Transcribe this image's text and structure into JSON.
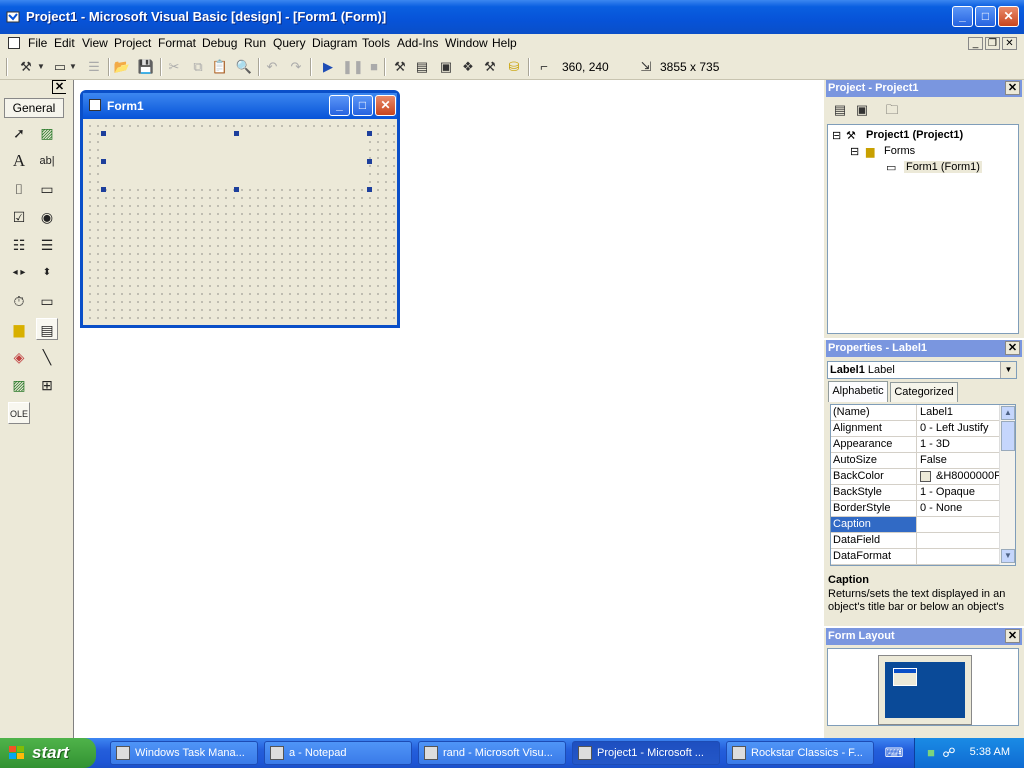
{
  "window": {
    "title": "Project1 - Microsoft Visual Basic [design] - [Form1 (Form)]",
    "minimize": "_",
    "maximize": "□",
    "close": "✕"
  },
  "menu": [
    "File",
    "Edit",
    "View",
    "Project",
    "Format",
    "Debug",
    "Run",
    "Query",
    "Diagram",
    "Tools",
    "Add-Ins",
    "Window",
    "Help"
  ],
  "toolbar": {
    "position": "360, 240",
    "size": "3855 x 735"
  },
  "toolbox": {
    "tab_label": "General",
    "close": "✕",
    "tools": [
      "pointer",
      "picturebox",
      "label",
      "textbox",
      "frame",
      "commandbutton",
      "checkbox",
      "optionbutton",
      "combobox",
      "listbox",
      "hscrollbar",
      "vscrollbar",
      "timer",
      "drivelistbox",
      "dirlistbox",
      "filelistbox",
      "shape",
      "line",
      "image",
      "data",
      "ole"
    ]
  },
  "form1": {
    "title": "Form1",
    "minimize": "_",
    "maximize": "□",
    "close": "✕"
  },
  "project_panel": {
    "title": "Project - Project1",
    "close": "✕",
    "tree": {
      "root": "Project1 (Project1)",
      "folder": "Forms",
      "item": "Form1 (Form1)"
    }
  },
  "properties_panel": {
    "title": "Properties - Label1",
    "close": "✕",
    "object": "Label1",
    "object_type": "Label",
    "tabs": [
      "Alphabetic",
      "Categorized"
    ],
    "rows": [
      {
        "name": "(Name)",
        "value": "Label1"
      },
      {
        "name": "Alignment",
        "value": "0 - Left Justify"
      },
      {
        "name": "Appearance",
        "value": "1 - 3D"
      },
      {
        "name": "AutoSize",
        "value": "False"
      },
      {
        "name": "BackColor",
        "value": "&H8000000F"
      },
      {
        "name": "BackStyle",
        "value": "1 - Opaque"
      },
      {
        "name": "BorderStyle",
        "value": "0 - None"
      },
      {
        "name": "Caption",
        "value": ""
      },
      {
        "name": "DataField",
        "value": ""
      },
      {
        "name": "DataFormat",
        "value": ""
      }
    ],
    "selected_row": "Caption",
    "description_title": "Caption",
    "description_text": "Returns/sets the text displayed in an object's title bar or below an object's"
  },
  "form_layout_panel": {
    "title": "Form Layout",
    "close": "✕"
  },
  "taskbar": {
    "start": "start",
    "tasks": [
      "Windows Task Mana...",
      "a - Notepad",
      "rand - Microsoft Visu...",
      "Project1 - Microsoft ...",
      "Rockstar Classics - F..."
    ],
    "active_task": "Project1 - Microsoft ...",
    "clock": "5:38 AM"
  },
  "colors": {
    "xp_blue": "#0753d8",
    "panel_title": "#7a96df",
    "start_green": "#329232",
    "selection": "#316ac5"
  }
}
